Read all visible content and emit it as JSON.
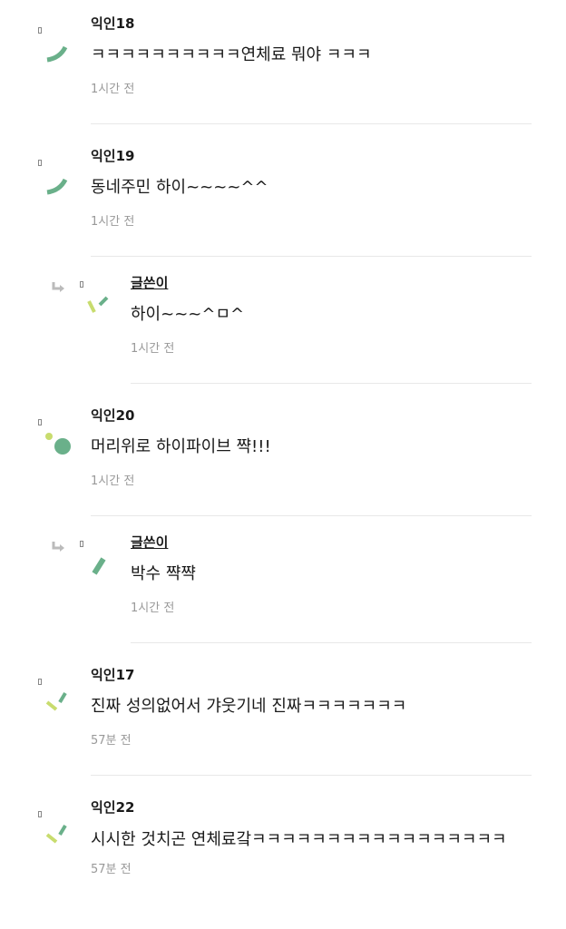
{
  "comments": [
    {
      "author": "익인18",
      "text": "ㅋㅋㅋㅋㅋㅋㅋㅋㅋㅋ연체료 뭐야 ㅋㅋㅋ",
      "time": "1시간 전"
    },
    {
      "author": "익인19",
      "text": "동네주민 하이~~~~^^",
      "time": "1시간 전"
    },
    {
      "author": "글쓴이",
      "text": "하이~~~^ㅁ^",
      "time": "1시간 전"
    },
    {
      "author": "익인20",
      "text": "머리위로 하이파이브 쨕!!!",
      "time": "1시간 전"
    },
    {
      "author": "글쓴이",
      "text": "박수 쨕쨕",
      "time": "1시간 전"
    },
    {
      "author": "익인17",
      "text": "진짜 성의없어서 갸웃기네 진짜ㅋㅋㅋㅋㅋㅋㅋ",
      "time": "57분 전"
    },
    {
      "author": "익인22",
      "text": "시시한 것치곤 연체료갘ㅋㅋㅋㅋㅋㅋㅋㅋㅋㅋㅋㅋㅋㅋㅋㅋㅋ",
      "time": "57분 전"
    }
  ],
  "colors": {
    "avatar_green_dark": "#6ab08a",
    "avatar_green_light": "#c8dc6e",
    "reply_arrow": "#bbbbbb"
  }
}
